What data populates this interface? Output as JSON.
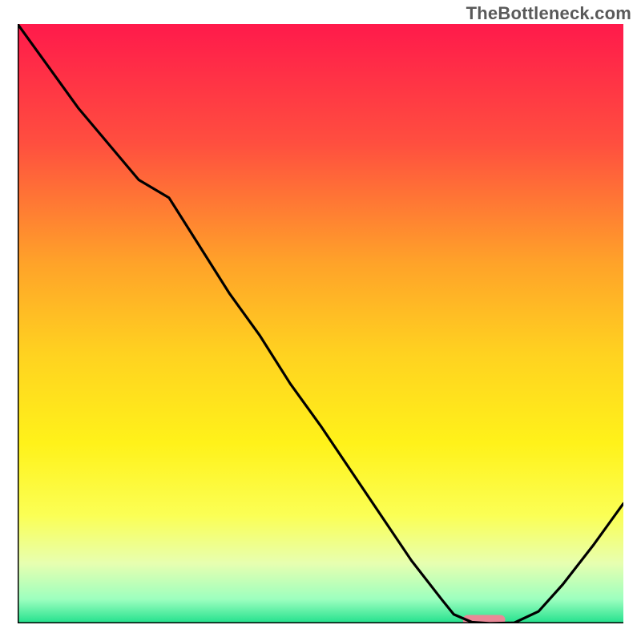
{
  "watermark": "TheBottleneck.com",
  "chart_data": {
    "type": "line",
    "title": "",
    "xlabel": "",
    "ylabel": "",
    "xlim": [
      0,
      100
    ],
    "ylim": [
      0,
      100
    ],
    "grid": false,
    "legend": false,
    "background_gradient": {
      "stops": [
        {
          "offset": 0.0,
          "color": "#ff1a4b"
        },
        {
          "offset": 0.2,
          "color": "#ff4f3f"
        },
        {
          "offset": 0.4,
          "color": "#ffa329"
        },
        {
          "offset": 0.55,
          "color": "#ffd220"
        },
        {
          "offset": 0.7,
          "color": "#fff21a"
        },
        {
          "offset": 0.82,
          "color": "#fbff55"
        },
        {
          "offset": 0.9,
          "color": "#e7ffb0"
        },
        {
          "offset": 0.96,
          "color": "#9cffbf"
        },
        {
          "offset": 1.0,
          "color": "#22e08c"
        }
      ]
    },
    "series": [
      {
        "name": "curve",
        "color": "#000000",
        "x": [
          0,
          5,
          10,
          15,
          20,
          25,
          30,
          35,
          40,
          45,
          50,
          55,
          60,
          65,
          70,
          72,
          75,
          78,
          82,
          86,
          90,
          95,
          100
        ],
        "y": [
          100,
          93,
          86,
          80,
          74,
          71,
          63,
          55,
          48,
          40,
          33,
          25.5,
          18,
          10.5,
          4,
          1.5,
          0.2,
          0.0,
          0.1,
          2,
          6.5,
          13,
          20
        ]
      }
    ],
    "annotations": [
      {
        "name": "min-marker",
        "shape": "rounded-rect",
        "fill": "#e98997",
        "x_center": 77,
        "y_center": 0.6,
        "width": 7,
        "height": 1.6
      }
    ]
  }
}
